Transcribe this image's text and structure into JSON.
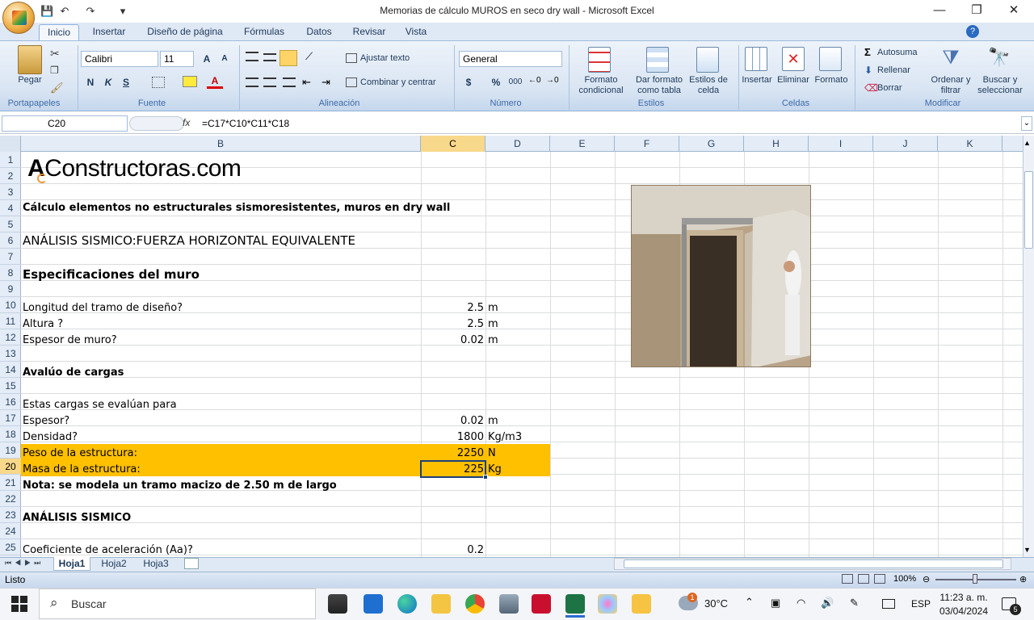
{
  "window": {
    "title": "Memorias de cálculo  MUROS en seco dry wall - Microsoft Excel"
  },
  "qat": {
    "save": "💾",
    "undo": "↶",
    "redo": "↷",
    "more": "▾"
  },
  "controls": {
    "minimize": "—",
    "maximize": "❐",
    "close": "✕"
  },
  "tabs": [
    "Inicio",
    "Insertar",
    "Diseño de página",
    "Fórmulas",
    "Datos",
    "Revisar",
    "Vista"
  ],
  "ribbon": {
    "portapapeles": {
      "pegar": "Pegar",
      "label": "Portapapeles"
    },
    "fuente": {
      "font": "Calibri",
      "size": "11",
      "label": "Fuente",
      "bold": "N",
      "italic": "K",
      "underline": "S",
      "grow": "A",
      "shrink": "A",
      "fontcolor": "A"
    },
    "alineacion": {
      "wrap": "Ajustar texto",
      "merge": "Combinar y centrar",
      "label": "Alineación"
    },
    "numero": {
      "format": "General",
      "currency": "$",
      "percent": "%",
      "thousands": "000",
      "label": "Número"
    },
    "estilos": {
      "formato_condicional": "Formato condicional",
      "dar_formato": "Dar formato como tabla",
      "estilos_celda": "Estilos de celda",
      "label": "Estilos"
    },
    "celdas": {
      "insertar": "Insertar",
      "eliminar": "Eliminar",
      "formato": "Formato",
      "label": "Celdas"
    },
    "modificar": {
      "autosuma": "Autosuma",
      "rellenar": "Rellenar",
      "borrar": "Borrar",
      "ordenar": "Ordenar y filtrar",
      "buscar": "Buscar y seleccionar",
      "label": "Modificar"
    }
  },
  "formula_bar": {
    "name_box": "C20",
    "fx": "fx",
    "formula": "=C17*C10*C11*C18"
  },
  "columns": [
    "B",
    "C",
    "D",
    "E",
    "F",
    "G",
    "H",
    "I",
    "J",
    "K"
  ],
  "rows": [
    "1",
    "2",
    "3",
    "4",
    "5",
    "6",
    "7",
    "8",
    "9",
    "10",
    "11",
    "12",
    "13",
    "14",
    "15",
    "16",
    "17",
    "18",
    "19",
    "20",
    "21",
    "22",
    "23",
    "24",
    "25"
  ],
  "sheet": {
    "logo_a": "A",
    "logo_rest": "Constructoras.com",
    "r4": "Cálculo elementos no estructurales sismoresistentes, muros en dry wall",
    "r6": "ANÁLISIS SISMICO:FUERZA HORIZONTAL EQUIVALENTE",
    "r8": "Especificaciones del muro",
    "r10": {
      "b": "Longitud del tramo de diseño?",
      "c": "2.5",
      "d": "m"
    },
    "r11": {
      "b": "Altura ?",
      "c": "2.5",
      "d": "m"
    },
    "r12": {
      "b": "Espesor de muro?",
      "c": "0.02",
      "d": "m"
    },
    "r14": "Avalúo de cargas",
    "r16": "Estas cargas se evalúan para",
    "r17": {
      "b": "Espesor?",
      "c": "0.02",
      "d": "m"
    },
    "r18": {
      "b": "Densidad?",
      "c": "1800",
      "d": "Kg/m3"
    },
    "r19": {
      "b": "Peso de la estructura:",
      "c": "2250",
      "d": "N"
    },
    "r20": {
      "b": "Masa de la estructura:",
      "c": "225",
      "d": "Kg"
    },
    "r21": "Nota: se modela un tramo macizo de 2.50 m de largo",
    "r23": "ANÁLISIS SISMICO",
    "r25": {
      "b": "Coeficiente de aceleración (Aa)?",
      "c": "0.2"
    }
  },
  "sheet_tabs": [
    "Hoja1",
    "Hoja2",
    "Hoja3"
  ],
  "status": {
    "ready": "Listo",
    "zoom": "100%"
  },
  "taskbar": {
    "search": "Buscar",
    "weather": "30°C",
    "lang": "ESP",
    "time": "11:23 a. m.",
    "date": "03/04/2024",
    "notif": "5",
    "badge": "1"
  },
  "colors": {
    "highlight": "#ffc000",
    "selection": "#f8d88a",
    "ribbon": "#dfe8f5"
  }
}
